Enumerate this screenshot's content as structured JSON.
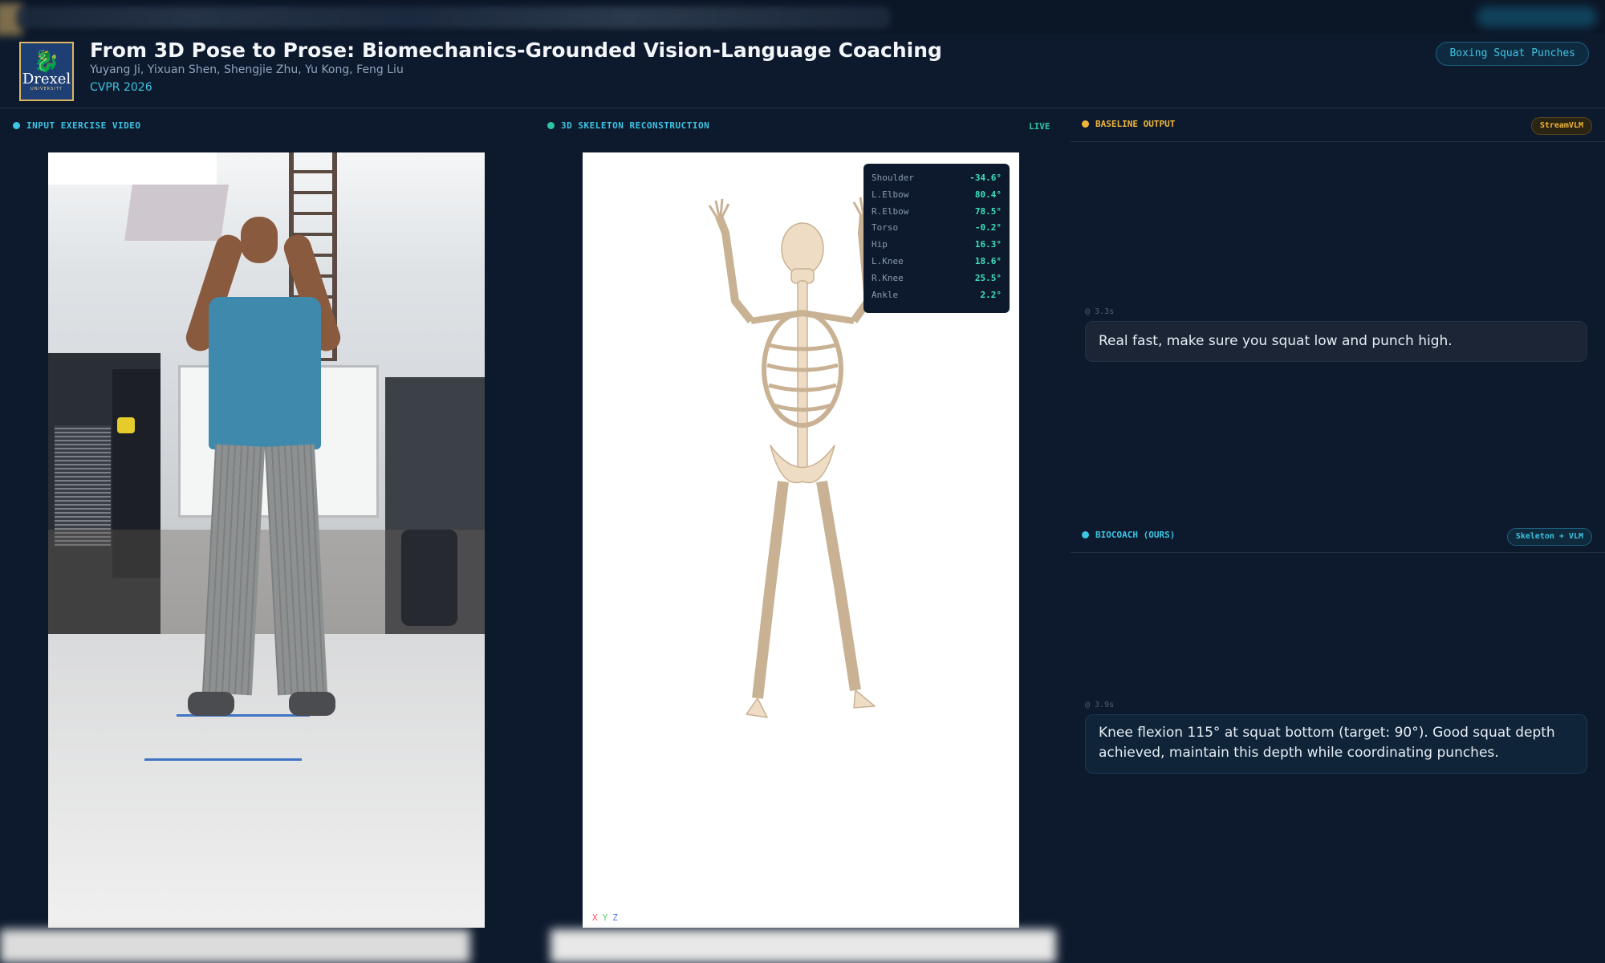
{
  "header": {
    "logo_name": "Drexel",
    "logo_sub": "UNIVERSITY",
    "title": "From 3D Pose to Prose: Biomechanics-Grounded Vision-Language Coaching",
    "authors": "Yuyang Ji, Yixuan Shen, Shengjie Zhu, Yu Kong, Feng Liu",
    "venue": "CVPR 2026",
    "exercise_pill": "Boxing Squat Punches"
  },
  "panels": {
    "video_label": "INPUT EXERCISE VIDEO",
    "skeleton_label": "3D SKELETON RECONSTRUCTION",
    "live_label": "LIVE"
  },
  "joint_angles": [
    {
      "name": "Shoulder",
      "value": "-34.6°"
    },
    {
      "name": "L.Elbow",
      "value": "80.4°"
    },
    {
      "name": "R.Elbow",
      "value": "78.5°"
    },
    {
      "name": "Torso",
      "value": "-0.2°"
    },
    {
      "name": "Hip",
      "value": "16.3°"
    },
    {
      "name": "L.Knee",
      "value": "18.6°"
    },
    {
      "name": "R.Knee",
      "value": "25.5°"
    },
    {
      "name": "Ankle",
      "value": "2.2°"
    }
  ],
  "axes": {
    "x": "X",
    "y": "Y",
    "z": "Z"
  },
  "baseline": {
    "title": "BASELINE OUTPUT",
    "tag": "StreamVLM",
    "timestamp": "@ 3.3s",
    "message": "Real fast, make sure you squat low and punch high."
  },
  "biocoach": {
    "title": "BIOCOACH (OURS)",
    "tag": "Skeleton + VLM",
    "timestamp": "@ 3.9s",
    "message": "Knee flexion 115° at squat bottom (target: 90°). Good squat depth achieved, maintain this depth while coordinating punches."
  },
  "colors": {
    "background": "#0d1a2d",
    "accent_cyan": "#3ec4e4",
    "accent_teal": "#2dc4a4",
    "baseline_amber": "#f0b43a"
  }
}
